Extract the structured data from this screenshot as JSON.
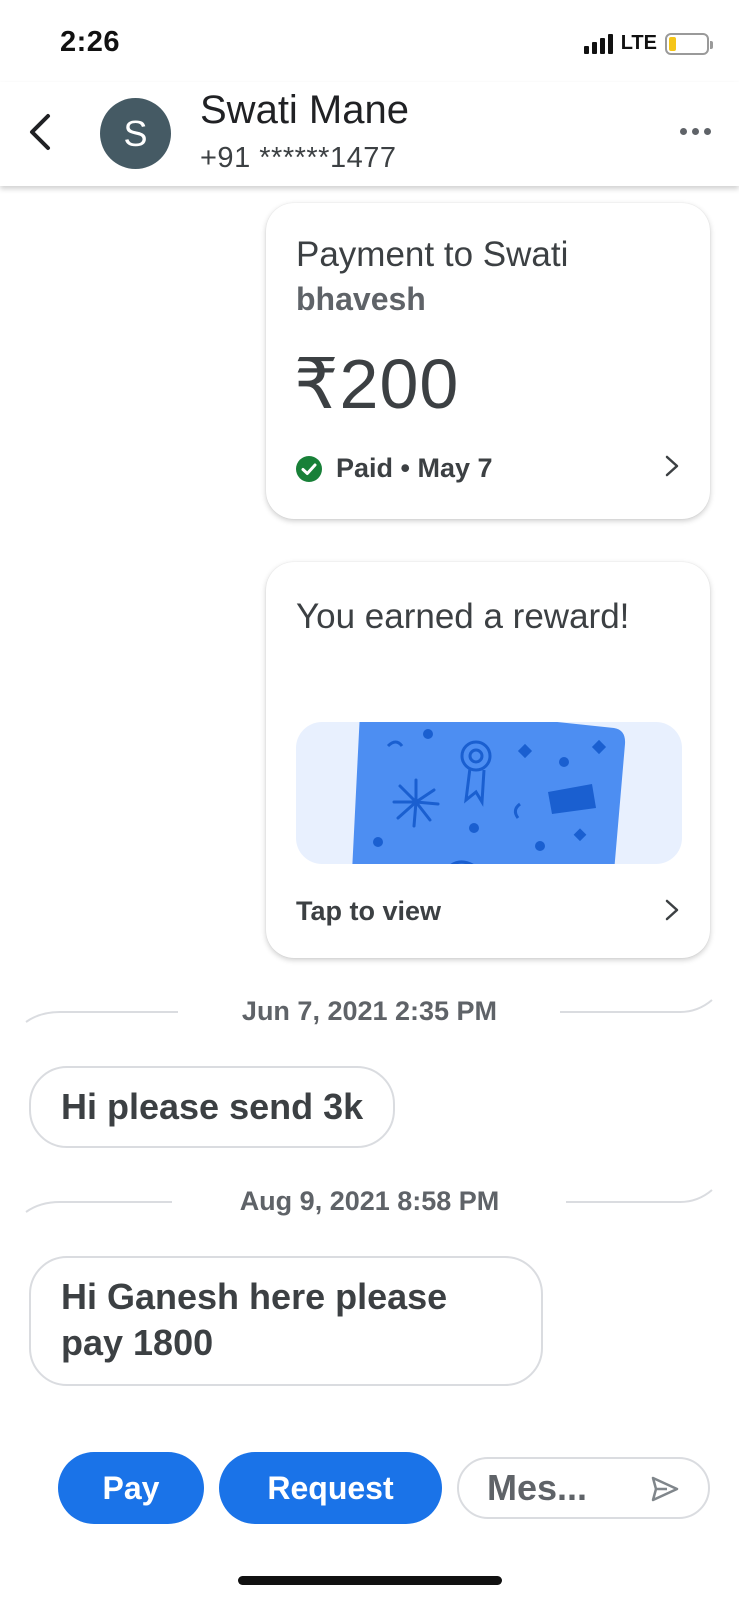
{
  "status_bar": {
    "time": "2:26",
    "network": "LTE",
    "battery_level": 0.2,
    "battery_color": "#f5c518"
  },
  "header": {
    "back_icon": "chevron-left-icon",
    "avatar_initial": "S",
    "avatar_color": "#455a64",
    "contact_name": "Swati Mane",
    "contact_phone": "+91 ******1477",
    "more_icon": "more-horizontal-icon"
  },
  "payment_card": {
    "title": "Payment to Swati",
    "subtitle": "bhavesh",
    "amount": "₹200",
    "status": "Paid • May 7",
    "status_icon": "check-circle-icon",
    "status_color": "#188038"
  },
  "reward_card": {
    "title": "You earned a reward!",
    "illustration": "scratch-card-icon",
    "action": "Tap to view"
  },
  "messages": [
    {
      "date": "Jun 7, 2021 2:35 PM",
      "text": "Hi please send 3k"
    },
    {
      "date": "Aug 9, 2021 8:58 PM",
      "text": "Hi Ganesh here please pay 1800"
    }
  ],
  "bottom_bar": {
    "pay_label": "Pay",
    "request_label": "Request",
    "message_placeholder": "Mes...",
    "send_icon": "send-icon",
    "accent_color": "#1a73e8"
  }
}
